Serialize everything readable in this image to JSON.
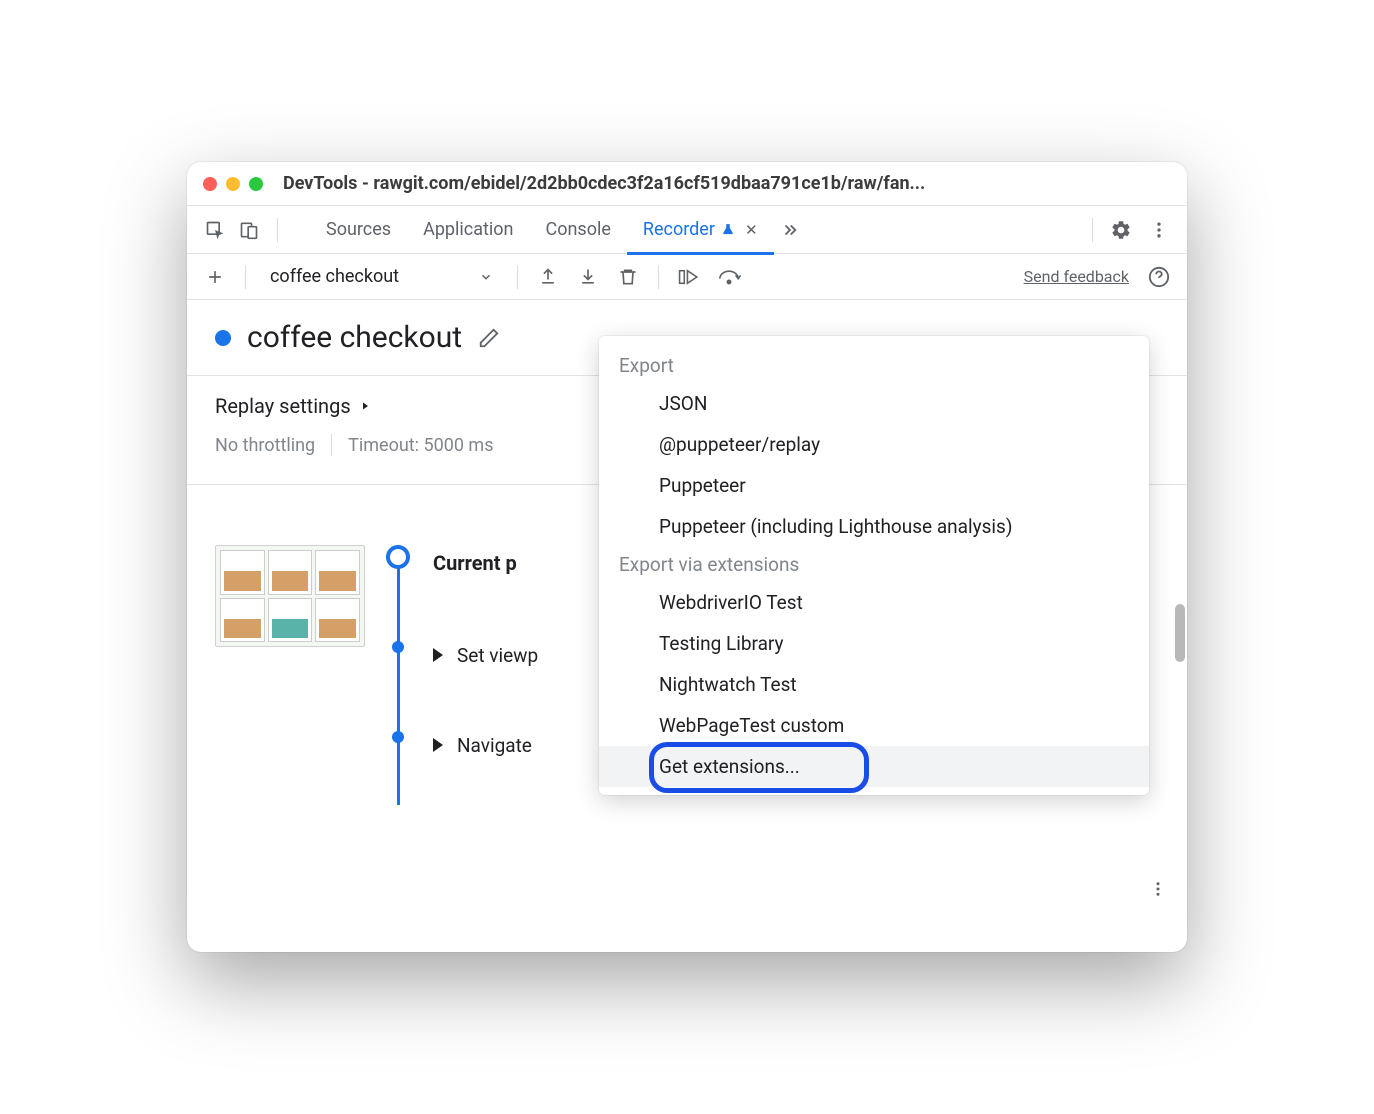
{
  "window": {
    "title": "DevTools - rawgit.com/ebidel/2d2bb0cdec3f2a16cf519dbaa791ce1b/raw/fan..."
  },
  "tabs": {
    "items": [
      "Sources",
      "Application",
      "Console",
      "Recorder"
    ],
    "active": "Recorder"
  },
  "toolbar": {
    "recording_name": "coffee checkout",
    "feedback_label": "Send feedback"
  },
  "recording": {
    "title": "coffee checkout",
    "settings_label": "Replay settings",
    "throttling": "No throttling",
    "timeout": "Timeout: 5000 ms"
  },
  "steps": {
    "current_label": "Current p",
    "items": [
      "Set viewp",
      "Navigate"
    ]
  },
  "dropdown": {
    "section1_label": "Export",
    "section1_items": [
      "JSON",
      "@puppeteer/replay",
      "Puppeteer",
      "Puppeteer (including Lighthouse analysis)"
    ],
    "section2_label": "Export via extensions",
    "section2_items": [
      "WebdriverIO Test",
      "Testing Library",
      "Nightwatch Test",
      "WebPageTest custom",
      "Get extensions..."
    ]
  }
}
